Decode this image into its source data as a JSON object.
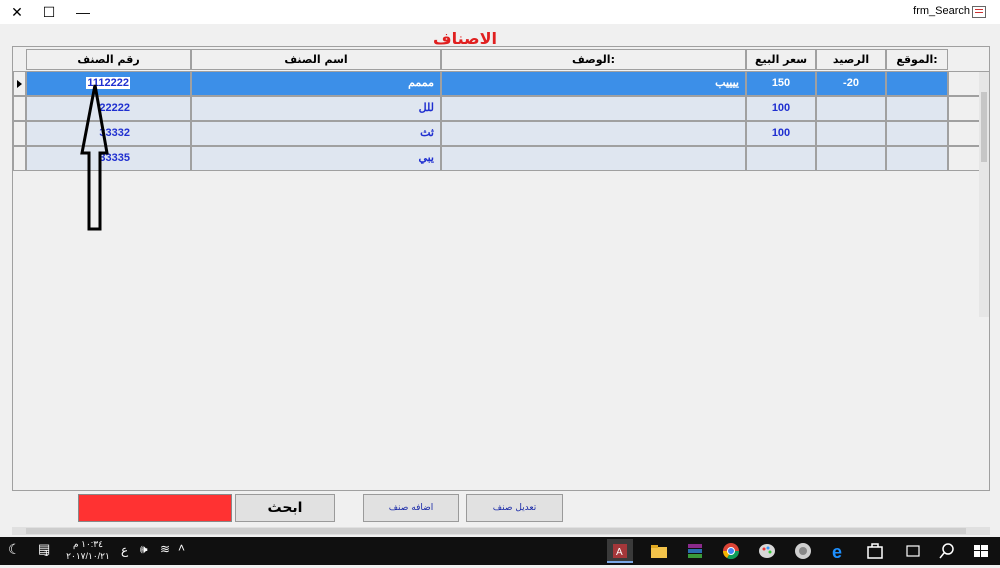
{
  "window": {
    "title": "frm_Search",
    "close_glyph": "✕",
    "maximize_glyph": "☐",
    "minimize_glyph": "—"
  },
  "form": {
    "title": "الاصناف"
  },
  "columns": [
    "الموقع:",
    "الرصيد",
    "سعر البيع",
    "الوصف:",
    "اسم الصنف",
    "رقم الصنف"
  ],
  "rows": [
    {
      "code": "1112222",
      "name": "مممم",
      "desc": "ييييب",
      "price": "150",
      "balance": "-20",
      "location": ""
    },
    {
      "code": "22222",
      "name": "للل",
      "desc": "",
      "price": "100",
      "balance": "",
      "location": ""
    },
    {
      "code": "33332",
      "name": "ثث",
      "desc": "",
      "price": "100",
      "balance": "",
      "location": ""
    },
    {
      "code": "33335",
      "name": "يبي",
      "desc": "",
      "price": "",
      "balance": "",
      "location": ""
    }
  ],
  "buttons": {
    "search": "ابحث",
    "add_item": "اضافه صنف",
    "edit_item": "تعديل صنف"
  },
  "taskbar": {
    "time": "١٠:٣٤ م",
    "date": "٢٠١٧/١٠/٢١",
    "lang": "ع",
    "notif_count": "1",
    "apps": [
      "access-icon",
      "file-explorer-icon",
      "winrar-icon",
      "chrome-icon",
      "paint-icon",
      "skype-icon",
      "ie-icon",
      "store-icon",
      "task-view-icon",
      "search-icon",
      "start-icon"
    ]
  },
  "colors": {
    "title_red": "#e02020",
    "selected_row": "#3c8fe8",
    "search_field": "#ff3232",
    "cell_text": "#1f2fd0"
  }
}
